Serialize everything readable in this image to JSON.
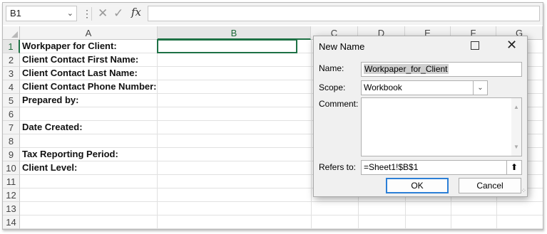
{
  "formula_bar": {
    "namebox_value": "B1",
    "fx_label": "fx",
    "formula_value": ""
  },
  "columns": [
    "A",
    "B",
    "C",
    "D",
    "E",
    "F",
    "G"
  ],
  "rows": [
    {
      "num": "1",
      "a": "Workpaper for Client:"
    },
    {
      "num": "2",
      "a": "Client Contact First Name:"
    },
    {
      "num": "3",
      "a": "Client Contact Last Name:"
    },
    {
      "num": "4",
      "a": "Client Contact Phone Number:"
    },
    {
      "num": "5",
      "a": "Prepared by:"
    },
    {
      "num": "6",
      "a": ""
    },
    {
      "num": "7",
      "a": "Date Created:"
    },
    {
      "num": "8",
      "a": ""
    },
    {
      "num": "9",
      "a": "Tax Reporting Period:"
    },
    {
      "num": "10",
      "a": "Client Level:"
    },
    {
      "num": "11",
      "a": ""
    },
    {
      "num": "12",
      "a": ""
    },
    {
      "num": "13",
      "a": ""
    },
    {
      "num": "14",
      "a": ""
    }
  ],
  "dialog": {
    "title": "New Name",
    "name_label": "Name:",
    "name_value": "Workpaper_for_Client",
    "scope_label": "Scope:",
    "scope_value": "Workbook",
    "comment_label": "Comment:",
    "comment_value": "",
    "refers_label": "Refers to:",
    "refers_value": "=Sheet1!$B$1",
    "ok_label": "OK",
    "cancel_label": "Cancel"
  },
  "colors": {
    "selection_green": "#1e7145",
    "default_button_border": "#2c7fd6"
  }
}
